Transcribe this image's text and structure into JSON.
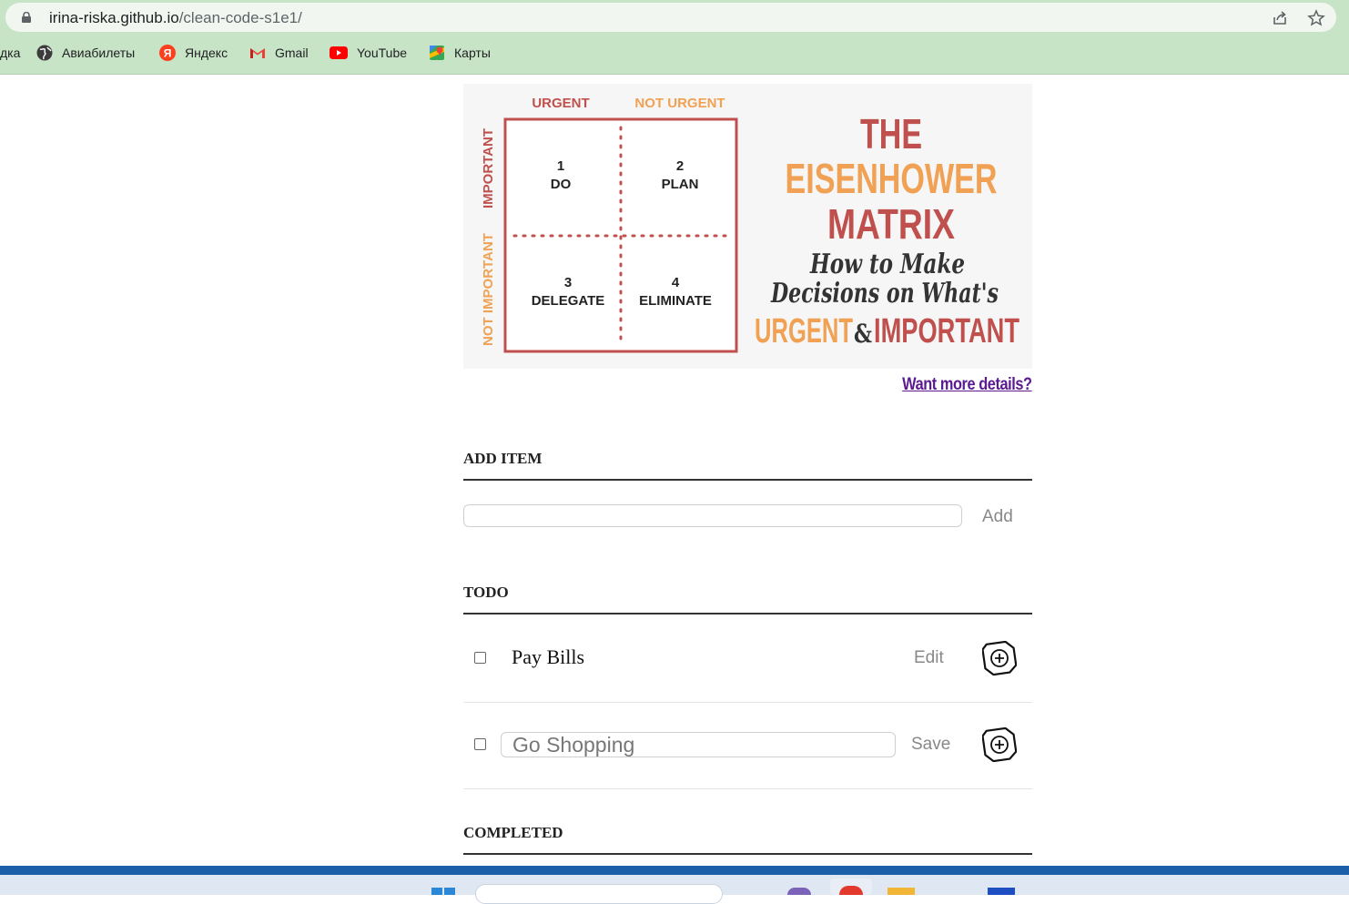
{
  "browser": {
    "url_host": "irina-riska.github.io",
    "url_path": "/clean-code-s1e1/",
    "bookmarks": [
      {
        "label": "дка",
        "icon": "folder-icon"
      },
      {
        "label": "Авиабилеты",
        "icon": "globe-icon"
      },
      {
        "label": "Яндекс",
        "icon": "yandex-icon"
      },
      {
        "label": "Gmail",
        "icon": "gmail-icon"
      },
      {
        "label": "YouTube",
        "icon": "youtube-icon"
      },
      {
        "label": "Карты",
        "icon": "maps-icon"
      }
    ]
  },
  "matrix": {
    "col_urgent": "URGENT",
    "col_not_urgent": "NOT URGENT",
    "row_important": "IMPORTANT",
    "row_not_important": "NOT IMPORTANT",
    "q1_num": "1",
    "q1_label": "DO",
    "q2_num": "2",
    "q2_label": "PLAN",
    "q3_num": "3",
    "q3_label": "DELEGATE",
    "q4_num": "4",
    "q4_label": "ELIMINATE",
    "title_1": "THE",
    "title_2": "EISENHOWER",
    "title_3": "MATRIX",
    "sub_1": "How to Make",
    "sub_2": "Decisions on What's",
    "sub_3a": "URGENT",
    "sub_3b": "&",
    "sub_3c": "IMPORTANT",
    "colors": {
      "red": "#c0504d",
      "orange": "#f0a154",
      "dark_red": "#c04a40"
    }
  },
  "details_link": "Want more details?",
  "add_section": {
    "heading": "ADD ITEM",
    "input_value": "",
    "add_label": "Add"
  },
  "todo": {
    "heading": "TODO",
    "items": [
      {
        "label": "Pay Bills",
        "action": "Edit",
        "checked": false
      },
      {
        "label": "Go Shopping",
        "action": "Save",
        "checked": false
      }
    ]
  },
  "completed": {
    "heading": "COMPLETED"
  }
}
